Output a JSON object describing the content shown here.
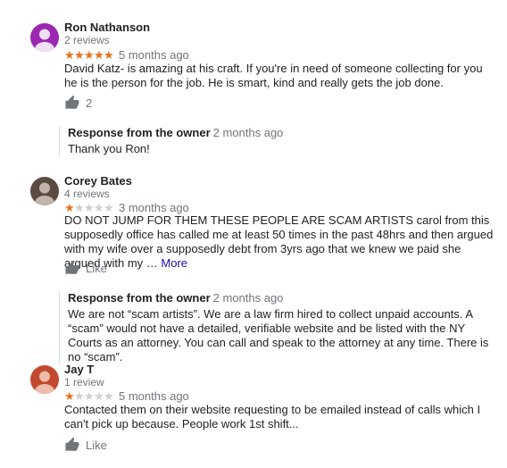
{
  "reviews": [
    {
      "name": "Ron Nathanson",
      "review_count": "2 reviews",
      "avatar_color": "#9c27b0",
      "rating": 5,
      "time": "5 months ago",
      "text": "David Katz- is amazing at his craft. If you're in need of someone collecting for you he is the person for the job. He is smart, kind and really gets the job done.",
      "likes": "2",
      "response": {
        "title": "Response from the owner",
        "time": "2 months ago",
        "text": "Thank you Ron!"
      }
    },
    {
      "name": "Corey Bates",
      "review_count": "4 reviews",
      "avatar_color": "#5b4a42",
      "rating": 1,
      "time": "3 months ago",
      "text": "DO NOT JUMP FOR THEM THESE PEOPLE ARE SCAM ARTISTS carol from this supposedly office has called me at least 50 times in the past 48hrs and then argued with my wife over a supposedly debt from 3yrs ago that we knew we paid she argued with my … ",
      "more": "More",
      "likes": "Like",
      "response": {
        "title": "Response from the owner",
        "time": "2 months ago",
        "text": "We are not “scam artists”. We are a law firm hired to collect unpaid accounts. A “scam” would not have a detailed, verifiable website and be listed with the NY Courts as an attorney. You can call and speak to the attorney at any time. There is no “scam”."
      }
    },
    {
      "name": "Jay T",
      "review_count": "1 review",
      "avatar_color": "#c1492e",
      "rating": 1,
      "time": "5 months ago",
      "text": "Contacted them on their website requesting to be emailed instead of calls which I can't pick up because. People work 1st shift...",
      "likes": "Like"
    }
  ],
  "colors": {
    "star_on": "#e7711b",
    "star_off": "#cfcfcf",
    "link": "#1a0dab",
    "muted": "#70757a"
  }
}
